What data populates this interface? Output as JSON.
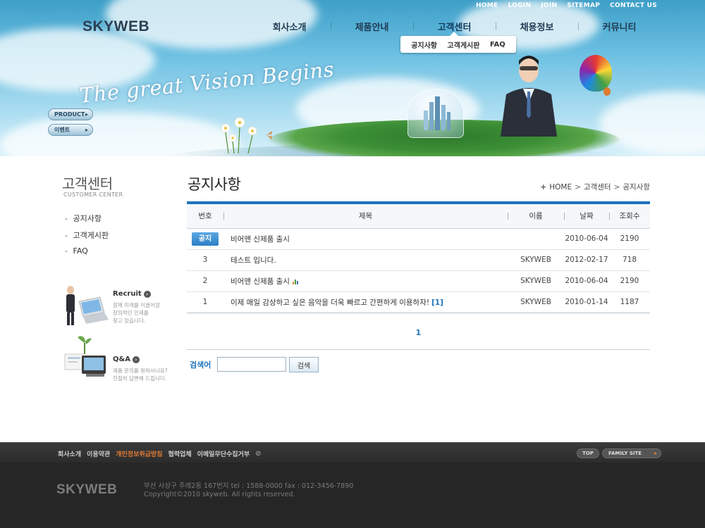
{
  "header": {
    "logo": "SKYWEB",
    "util_nav": [
      "HOME",
      "LOGIN",
      "JOIN",
      "SITEMAP",
      "CONTACT US"
    ],
    "gnb": [
      "회사소개",
      "제품안내",
      "고객센터",
      "채용정보",
      "커뮤니티"
    ],
    "subnav": [
      "공지사항",
      "고객게시판",
      "FAQ"
    ],
    "slogan": "The great Vision Begins",
    "quick_buttons": [
      "PRODUCT",
      "이벤트"
    ]
  },
  "sidebar": {
    "title": "고객센터",
    "subtitle": "CUSTOMER CENTER",
    "menu": [
      "공지사항",
      "고객게시판",
      "FAQ"
    ],
    "promos": [
      {
        "title": "Recruit",
        "desc": [
          "함께 미래를 이끌어갈",
          "창의적인 인재를",
          "찾고 있습니다."
        ]
      },
      {
        "title": "Q&A",
        "desc": [
          "제품 문의를 원하시나요?",
          "친절히 답변해 드립니다."
        ]
      }
    ]
  },
  "main": {
    "page_title": "공지사항",
    "breadcrumb": [
      "HOME",
      "고객센터",
      "공지사항"
    ],
    "columns": [
      "번호",
      "제목",
      "이름",
      "날짜",
      "조회수"
    ],
    "rows": [
      {
        "no": "공지",
        "subject": "비어맨 신제품 출시",
        "comments": "",
        "name": "",
        "date": "2010-06-04",
        "views": "2190",
        "is_notice": true
      },
      {
        "no": "3",
        "subject": "테스트 입니다.",
        "comments": "",
        "name": "SKYWEB",
        "date": "2012-02-17",
        "views": "718"
      },
      {
        "no": "2",
        "subject": "비어맨 신제품 출시",
        "comments": "",
        "name": "SKYWEB",
        "date": "2010-06-04",
        "views": "2190",
        "has_chart_icon": true
      },
      {
        "no": "1",
        "subject": "이제 매일 감상하고 싶은 음악을 더욱 빠르고 간편하게 이용하자!",
        "comments": "[1]",
        "name": "SKYWEB",
        "date": "2010-01-14",
        "views": "1187"
      }
    ],
    "pagination": [
      "1"
    ],
    "search": {
      "label": "검색어",
      "value": "",
      "button": "검색"
    }
  },
  "footer": {
    "links": [
      "회사소개",
      "이용약관",
      "개인정보취급방침",
      "협력업체",
      "이메일무단수집거부"
    ],
    "highlight_link_index": 2,
    "top_button": "TOP",
    "family_site": "FAMILY SITE",
    "logo": "SKYWEB",
    "address": "부산 사상구 주례2동 167번지 tel : 1588-0000 fax : 012-3456-7890",
    "copyright": "Copyright©2010 skyweb. All rights reserved."
  },
  "colors": {
    "accent": "#1d73ba",
    "footer_highlight": "#e07a35",
    "notice_badge": "#3a8bd0"
  }
}
